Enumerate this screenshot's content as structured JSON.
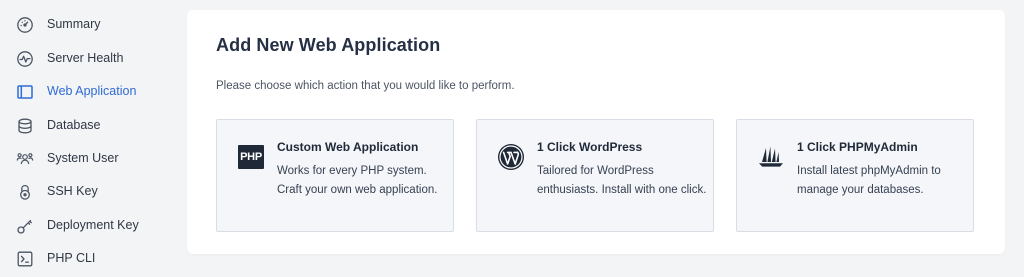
{
  "sidebar": {
    "items": [
      {
        "label": "Summary",
        "icon": "gauge-icon",
        "active": false
      },
      {
        "label": "Server Health",
        "icon": "pulse-icon",
        "active": false
      },
      {
        "label": "Web Application",
        "icon": "browser-window-icon",
        "active": true
      },
      {
        "label": "Database",
        "icon": "database-icon",
        "active": false
      },
      {
        "label": "System User",
        "icon": "users-icon",
        "active": false
      },
      {
        "label": "SSH Key",
        "icon": "lock-icon",
        "active": false
      },
      {
        "label": "Deployment Key",
        "icon": "key-icon",
        "active": false
      },
      {
        "label": "PHP CLI",
        "icon": "terminal-icon",
        "active": false
      }
    ]
  },
  "main": {
    "title": "Add New Web Application",
    "subtitle": "Please choose which action that you would like to perform.",
    "options": [
      {
        "title": "Custom Web Application",
        "description": "Works for every PHP system. Craft your own web application.",
        "icon": "php-icon",
        "icon_text": "PHP"
      },
      {
        "title": "1 Click WordPress",
        "description": "Tailored for WordPress enthusiasts. Install with one click.",
        "icon": "wordpress-icon"
      },
      {
        "title": "1 Click PHPMyAdmin",
        "description": "Install latest phpMyAdmin to manage your databases.",
        "icon": "phpmyadmin-sailboat-icon"
      }
    ]
  },
  "colors": {
    "accent": "#2f6bd6",
    "background": "#f3f4f6",
    "card": "#ffffff",
    "option_background": "#f4f6fa",
    "option_border": "#d8dde6"
  }
}
